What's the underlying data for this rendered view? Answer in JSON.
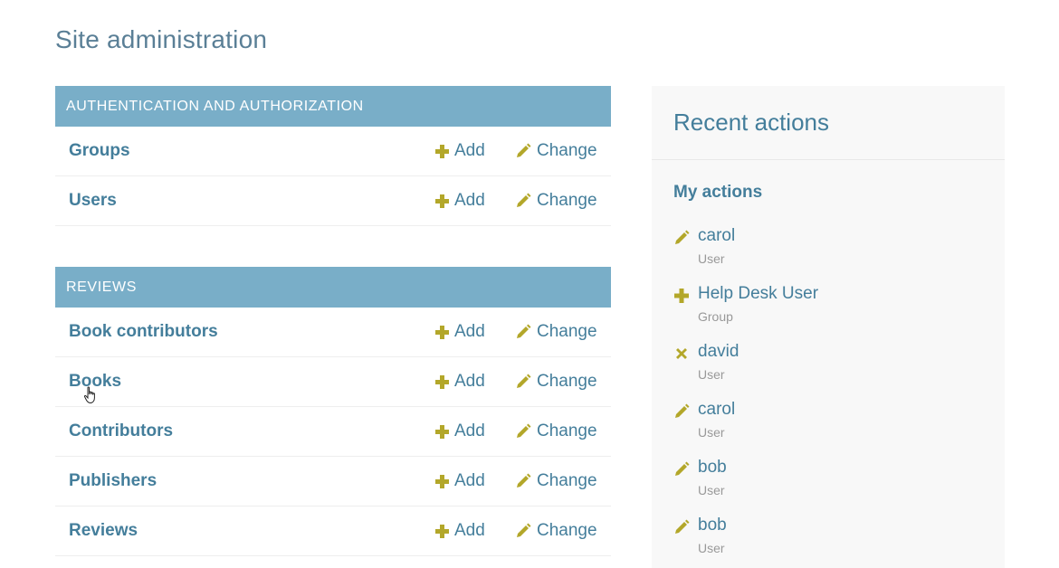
{
  "page_title": "Site administration",
  "modules": [
    {
      "caption": "AUTHENTICATION AND AUTHORIZATION",
      "models": [
        {
          "name": "Groups",
          "add": "Add",
          "change": "Change"
        },
        {
          "name": "Users",
          "add": "Add",
          "change": "Change"
        }
      ]
    },
    {
      "caption": "REVIEWS",
      "models": [
        {
          "name": "Book contributors",
          "add": "Add",
          "change": "Change"
        },
        {
          "name": "Books",
          "add": "Add",
          "change": "Change"
        },
        {
          "name": "Contributors",
          "add": "Add",
          "change": "Change"
        },
        {
          "name": "Publishers",
          "add": "Add",
          "change": "Change"
        },
        {
          "name": "Reviews",
          "add": "Add",
          "change": "Change"
        }
      ]
    }
  ],
  "recent_actions": {
    "title": "Recent actions",
    "subtitle": "My actions",
    "items": [
      {
        "icon": "pencil-icon",
        "label": "carol",
        "type": "User"
      },
      {
        "icon": "plus-icon",
        "label": "Help Desk User",
        "type": "Group"
      },
      {
        "icon": "delete-icon",
        "label": "david",
        "type": "User"
      },
      {
        "icon": "pencil-icon",
        "label": "carol",
        "type": "User"
      },
      {
        "icon": "pencil-icon",
        "label": "bob",
        "type": "User"
      },
      {
        "icon": "pencil-icon",
        "label": "bob",
        "type": "User"
      }
    ]
  },
  "colors": {
    "header_bg": "#79aec8",
    "link": "#447e9b",
    "title": "#5a7f96",
    "icon": "#b3a72a"
  }
}
